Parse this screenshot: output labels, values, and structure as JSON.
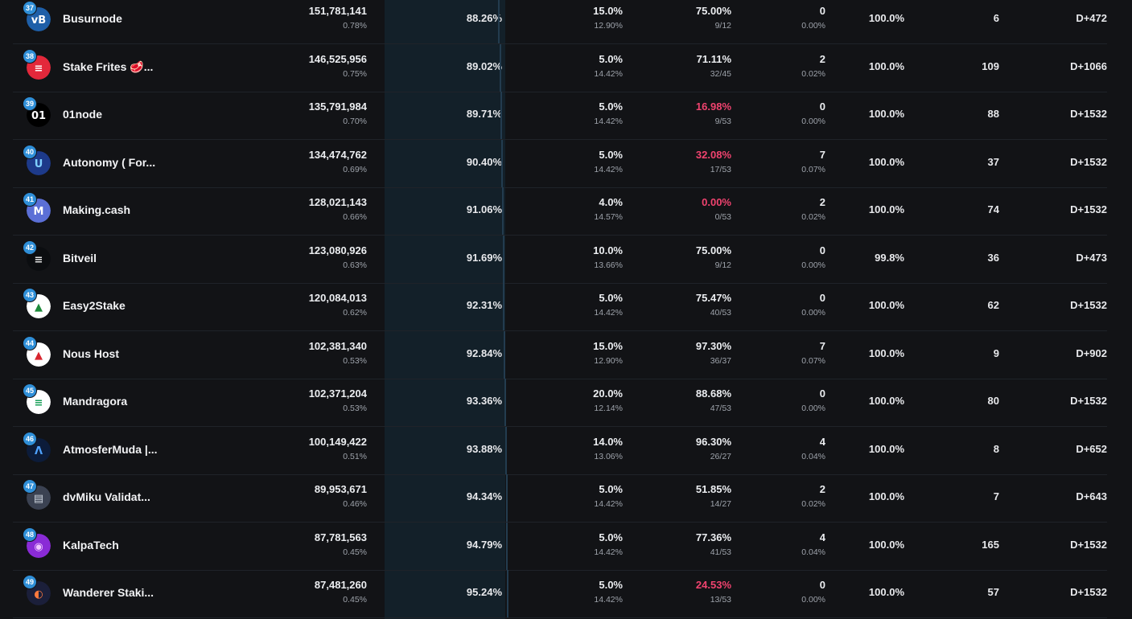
{
  "validators": [
    {
      "rank": "37",
      "name": "Busurnode",
      "stake": "151,781,141",
      "stake_pct": "0.78%",
      "cumulative": "88.26%",
      "commission": "15.0%",
      "commission_sub": "12.90%",
      "vote": "75.00%",
      "vote_sub": "9/12",
      "vote_alert": false,
      "skipped": "0",
      "skipped_pct": "0.00%",
      "uptime": "100.0%",
      "delegators": "6",
      "version": "D+472",
      "logo": {
        "bg": "#1e5fa8",
        "fg": "#ffffff",
        "text": "vB"
      }
    },
    {
      "rank": "38",
      "name": "Stake Frites 🥩...",
      "stake": "146,525,956",
      "stake_pct": "0.75%",
      "cumulative": "89.02%",
      "commission": "5.0%",
      "commission_sub": "14.42%",
      "vote": "71.11%",
      "vote_sub": "32/45",
      "vote_alert": false,
      "skipped": "2",
      "skipped_pct": "0.02%",
      "uptime": "100.0%",
      "delegators": "109",
      "version": "D+1066",
      "logo": {
        "bg": "#e3283b",
        "fg": "#ffffff",
        "text": "≡"
      }
    },
    {
      "rank": "39",
      "name": "01node",
      "stake": "135,791,984",
      "stake_pct": "0.70%",
      "cumulative": "89.71%",
      "commission": "5.0%",
      "commission_sub": "14.42%",
      "vote": "16.98%",
      "vote_sub": "9/53",
      "vote_alert": true,
      "skipped": "0",
      "skipped_pct": "0.00%",
      "uptime": "100.0%",
      "delegators": "88",
      "version": "D+1532",
      "logo": {
        "bg": "#000000",
        "fg": "#ffffff",
        "text": "01"
      }
    },
    {
      "rank": "40",
      "name": "Autonomy ( For...",
      "stake": "134,474,762",
      "stake_pct": "0.69%",
      "cumulative": "90.40%",
      "commission": "5.0%",
      "commission_sub": "14.42%",
      "vote": "32.08%",
      "vote_sub": "17/53",
      "vote_alert": true,
      "skipped": "7",
      "skipped_pct": "0.07%",
      "uptime": "100.0%",
      "delegators": "37",
      "version": "D+1532",
      "logo": {
        "bg": "#1d3a8a",
        "fg": "#7fd0ff",
        "text": "U"
      }
    },
    {
      "rank": "41",
      "name": "Making.cash",
      "stake": "128,021,143",
      "stake_pct": "0.66%",
      "cumulative": "91.06%",
      "commission": "4.0%",
      "commission_sub": "14.57%",
      "vote": "0.00%",
      "vote_sub": "0/53",
      "vote_alert": true,
      "skipped": "2",
      "skipped_pct": "0.02%",
      "uptime": "100.0%",
      "delegators": "74",
      "version": "D+1532",
      "logo": {
        "bg": "#5b6fd6",
        "fg": "#ffffff",
        "text": "M"
      }
    },
    {
      "rank": "42",
      "name": "Bitveil",
      "stake": "123,080,926",
      "stake_pct": "0.63%",
      "cumulative": "91.69%",
      "commission": "10.0%",
      "commission_sub": "13.66%",
      "vote": "75.00%",
      "vote_sub": "9/12",
      "vote_alert": false,
      "skipped": "0",
      "skipped_pct": "0.00%",
      "uptime": "99.8%",
      "delegators": "36",
      "version": "D+473",
      "logo": {
        "bg": "#0b0d10",
        "fg": "#e6e6e6",
        "text": "≡"
      }
    },
    {
      "rank": "43",
      "name": "Easy2Stake",
      "stake": "120,084,013",
      "stake_pct": "0.62%",
      "cumulative": "92.31%",
      "commission": "5.0%",
      "commission_sub": "14.42%",
      "vote": "75.47%",
      "vote_sub": "40/53",
      "vote_alert": false,
      "skipped": "0",
      "skipped_pct": "0.00%",
      "uptime": "100.0%",
      "delegators": "62",
      "version": "D+1532",
      "logo": {
        "bg": "#ffffff",
        "fg": "#1d8a3a",
        "text": "▲"
      }
    },
    {
      "rank": "44",
      "name": "Nous Host",
      "stake": "102,381,340",
      "stake_pct": "0.53%",
      "cumulative": "92.84%",
      "commission": "15.0%",
      "commission_sub": "12.90%",
      "vote": "97.30%",
      "vote_sub": "36/37",
      "vote_alert": false,
      "skipped": "7",
      "skipped_pct": "0.07%",
      "uptime": "100.0%",
      "delegators": "9",
      "version": "D+902",
      "logo": {
        "bg": "#ffffff",
        "fg": "#d8262f",
        "text": "▲"
      }
    },
    {
      "rank": "45",
      "name": "Mandragora",
      "stake": "102,371,204",
      "stake_pct": "0.53%",
      "cumulative": "93.36%",
      "commission": "20.0%",
      "commission_sub": "12.14%",
      "vote": "88.68%",
      "vote_sub": "47/53",
      "vote_alert": false,
      "skipped": "0",
      "skipped_pct": "0.00%",
      "uptime": "100.0%",
      "delegators": "80",
      "version": "D+1532",
      "logo": {
        "bg": "#ffffff",
        "fg": "#1aa05a",
        "text": "≡"
      }
    },
    {
      "rank": "46",
      "name": "AtmosferMuda |...",
      "stake": "100,149,422",
      "stake_pct": "0.51%",
      "cumulative": "93.88%",
      "commission": "14.0%",
      "commission_sub": "13.06%",
      "vote": "96.30%",
      "vote_sub": "26/27",
      "vote_alert": false,
      "skipped": "4",
      "skipped_pct": "0.04%",
      "uptime": "100.0%",
      "delegators": "8",
      "version": "D+652",
      "logo": {
        "bg": "#0c1c3a",
        "fg": "#4fa3ff",
        "text": "Λ"
      }
    },
    {
      "rank": "47",
      "name": "dvMiku Validat...",
      "stake": "89,953,671",
      "stake_pct": "0.46%",
      "cumulative": "94.34%",
      "commission": "5.0%",
      "commission_sub": "14.42%",
      "vote": "51.85%",
      "vote_sub": "14/27",
      "vote_alert": false,
      "skipped": "2",
      "skipped_pct": "0.02%",
      "uptime": "100.0%",
      "delegators": "7",
      "version": "D+643",
      "logo": {
        "bg": "#3b4252",
        "fg": "#cfd6e0",
        "text": "▤"
      }
    },
    {
      "rank": "48",
      "name": "KalpaTech",
      "stake": "87,781,563",
      "stake_pct": "0.45%",
      "cumulative": "94.79%",
      "commission": "5.0%",
      "commission_sub": "14.42%",
      "vote": "77.36%",
      "vote_sub": "41/53",
      "vote_alert": false,
      "skipped": "4",
      "skipped_pct": "0.04%",
      "uptime": "100.0%",
      "delegators": "165",
      "version": "D+1532",
      "logo": {
        "bg": "#8a2bd6",
        "fg": "#f0c8ff",
        "text": "◉"
      }
    },
    {
      "rank": "49",
      "name": "Wanderer Staki...",
      "stake": "87,481,260",
      "stake_pct": "0.45%",
      "cumulative": "95.24%",
      "commission": "5.0%",
      "commission_sub": "14.42%",
      "vote": "24.53%",
      "vote_sub": "13/53",
      "vote_alert": true,
      "skipped": "0",
      "skipped_pct": "0.00%",
      "uptime": "100.0%",
      "delegators": "57",
      "version": "D+1532",
      "logo": {
        "bg": "#1b1f3a",
        "fg": "#ff7a3d",
        "text": "◐"
      }
    }
  ]
}
